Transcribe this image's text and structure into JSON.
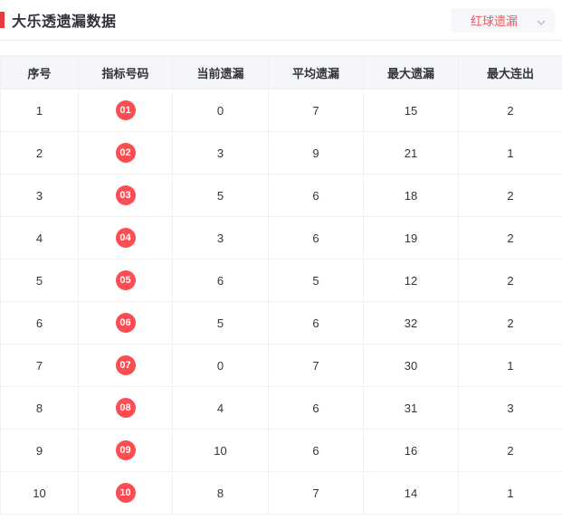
{
  "page": {
    "title": "大乐透遗漏数据"
  },
  "filter": {
    "selected_option": "红球遗漏",
    "icon": "chevron-down-icon"
  },
  "colors": {
    "accent_red": "#e8393f",
    "badge_red": "#fb4d52",
    "dropdown_text_red": "#f4555a",
    "header_bg": "#f5f6fa",
    "border": "#eef0f3",
    "text_dark": "#33343c"
  },
  "table": {
    "columns": [
      "序号",
      "指标号码",
      "当前遗漏",
      "平均遗漏",
      "最大遗漏",
      "最大连出"
    ],
    "rows": [
      {
        "index": "1",
        "number": "01",
        "current": "0",
        "average": "7",
        "max_miss": "15",
        "max_streak": "2"
      },
      {
        "index": "2",
        "number": "02",
        "current": "3",
        "average": "9",
        "max_miss": "21",
        "max_streak": "1"
      },
      {
        "index": "3",
        "number": "03",
        "current": "5",
        "average": "6",
        "max_miss": "18",
        "max_streak": "2"
      },
      {
        "index": "4",
        "number": "04",
        "current": "3",
        "average": "6",
        "max_miss": "19",
        "max_streak": "2"
      },
      {
        "index": "5",
        "number": "05",
        "current": "6",
        "average": "5",
        "max_miss": "12",
        "max_streak": "2"
      },
      {
        "index": "6",
        "number": "06",
        "current": "5",
        "average": "6",
        "max_miss": "32",
        "max_streak": "2"
      },
      {
        "index": "7",
        "number": "07",
        "current": "0",
        "average": "7",
        "max_miss": "30",
        "max_streak": "1"
      },
      {
        "index": "8",
        "number": "08",
        "current": "4",
        "average": "6",
        "max_miss": "31",
        "max_streak": "3"
      },
      {
        "index": "9",
        "number": "09",
        "current": "10",
        "average": "6",
        "max_miss": "16",
        "max_streak": "2"
      },
      {
        "index": "10",
        "number": "10",
        "current": "8",
        "average": "7",
        "max_miss": "14",
        "max_streak": "1"
      }
    ]
  }
}
